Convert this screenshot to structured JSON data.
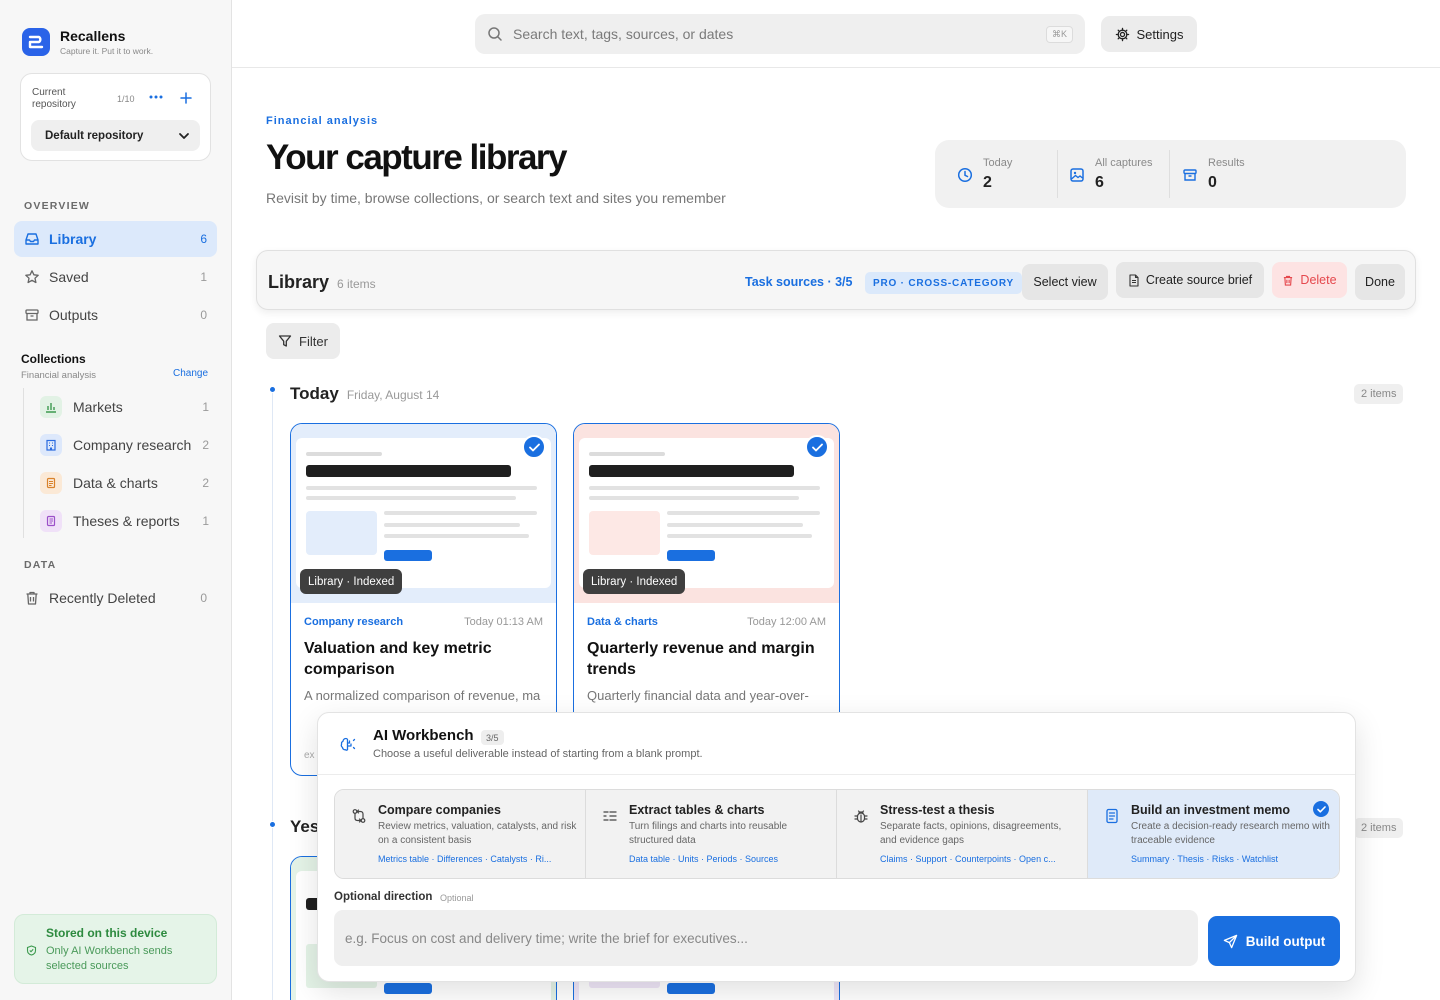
{
  "app": {
    "name": "Recallens",
    "tagline": "Capture it. Put it to work."
  },
  "repo": {
    "label": "Current repository",
    "count": "1/10",
    "selected": "Default repository"
  },
  "sidebar": {
    "overview_label": "OVERVIEW",
    "items": [
      {
        "label": "Library",
        "count": "6",
        "icon": "inbox-icon"
      },
      {
        "label": "Saved",
        "count": "1",
        "icon": "star-icon"
      },
      {
        "label": "Outputs",
        "count": "0",
        "icon": "archive-icon"
      }
    ],
    "collections": {
      "title": "Collections",
      "subtitle": "Financial analysis",
      "change": "Change",
      "items": [
        {
          "label": "Markets",
          "count": "1",
          "icon": "bar-chart-icon",
          "color": "#3d9a4f"
        },
        {
          "label": "Company research",
          "count": "2",
          "icon": "building-icon",
          "color": "#2a6be0"
        },
        {
          "label": "Data & charts",
          "count": "2",
          "icon": "sheet-icon",
          "color": "#d9822b"
        },
        {
          "label": "Theses & reports",
          "count": "1",
          "icon": "notebook-icon",
          "color": "#9b4fc9"
        }
      ]
    },
    "data_label": "DATA",
    "data_items": [
      {
        "label": "Recently Deleted",
        "count": "0",
        "icon": "trash-icon"
      }
    ],
    "stored": {
      "title": "Stored on this device",
      "text": "Only AI Workbench sends selected sources"
    }
  },
  "topbar": {
    "search_placeholder": "Search text, tags, sources, or dates",
    "shortcut": "⌘K",
    "settings": "Settings"
  },
  "header": {
    "eyebrow": "Financial analysis",
    "title": "Your capture library",
    "subtitle": "Revisit by time, browse collections, or search text and sites you remember"
  },
  "stats": [
    {
      "label": "Today",
      "value": "2",
      "icon": "clock-icon"
    },
    {
      "label": "All captures",
      "value": "6",
      "icon": "image-icon"
    },
    {
      "label": "Results",
      "value": "0",
      "icon": "archive-icon"
    }
  ],
  "library_bar": {
    "title": "Library",
    "count": "6 items",
    "task_sources": "Task sources · 3/5",
    "badge": "PRO · CROSS-CATEGORY",
    "select_view": "Select view",
    "create_brief": "Create source brief",
    "delete": "Delete",
    "done": "Done"
  },
  "filter": "Filter",
  "today": {
    "title": "Today",
    "date": "Friday, August 14",
    "items": "2 items"
  },
  "cards": [
    {
      "tag": "Library · Indexed",
      "category": "Company research",
      "time": "Today 01:13 AM",
      "title": "Valuation and key metric comparison",
      "desc": "A normalized comparison of revenue, ma",
      "ex": "ex"
    },
    {
      "tag": "Library · Indexed",
      "category": "Data & charts",
      "time": "Today 12:00 AM",
      "title": "Quarterly revenue and margin trends",
      "desc": "Quarterly financial data and year-over-",
      "ex": ""
    }
  ],
  "yesterday": {
    "title": "Yes",
    "items": "2 items"
  },
  "workbench": {
    "title": "AI Workbench",
    "badge": "3/5",
    "subtitle": "Choose a useful deliverable instead of starting from a blank prompt.",
    "options": [
      {
        "title": "Compare companies",
        "desc": "Review metrics, valuation, catalysts, and risk on a consistent basis",
        "tags": "Metrics table · Differences · Catalysts · Ri...",
        "icon": "compare-icon",
        "selected": false
      },
      {
        "title": "Extract tables & charts",
        "desc": "Turn filings and charts into reusable structured data",
        "tags": "Data table · Units · Periods · Sources",
        "icon": "list-indent-icon",
        "selected": false
      },
      {
        "title": "Stress-test a thesis",
        "desc": "Separate facts, opinions, disagreements, and evidence gaps",
        "tags": "Claims · Support · Counterpoints · Open c...",
        "icon": "bug-icon",
        "selected": false
      },
      {
        "title": "Build an investment memo",
        "desc": "Create a decision-ready research memo with traceable evidence",
        "tags": "Summary · Thesis · Risks · Watchlist",
        "icon": "memo-icon",
        "selected": true
      }
    ],
    "direction_label": "Optional direction",
    "direction_optional": "Optional",
    "direction_placeholder": "e.g. Focus on cost and delivery time; write the brief for executives...",
    "build": "Build output"
  }
}
